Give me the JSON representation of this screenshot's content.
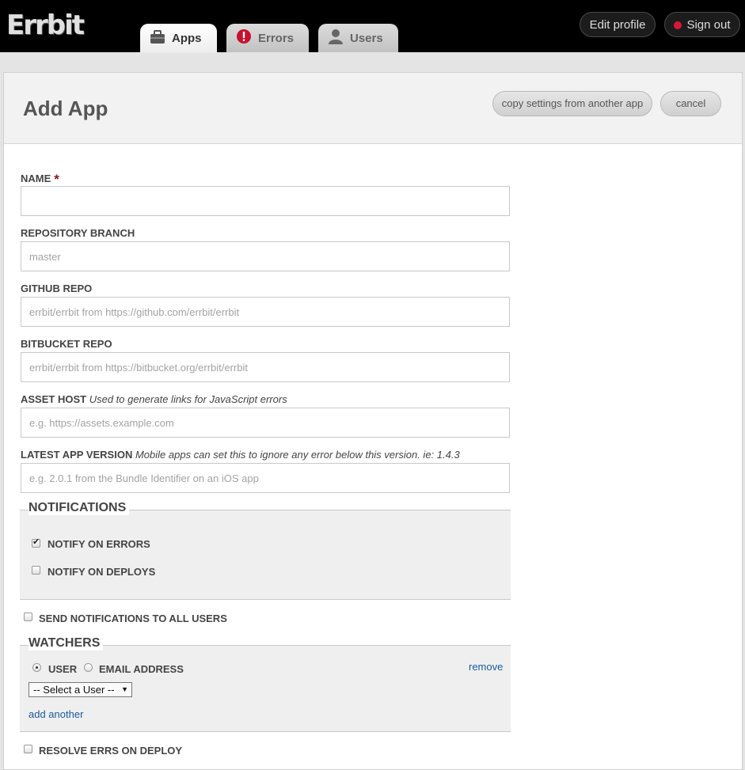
{
  "header": {
    "logo": "Errbit",
    "tabs": [
      {
        "label": "Apps",
        "icon": "briefcase-icon",
        "active": true
      },
      {
        "label": "Errors",
        "icon": "exclamation-icon",
        "active": false
      },
      {
        "label": "Users",
        "icon": "user-icon",
        "active": false
      }
    ],
    "edit_profile": "Edit profile",
    "sign_out": "Sign out",
    "sign_out_dot_color": "#d9163a"
  },
  "page": {
    "title": "Add App",
    "copy_settings": "copy settings from another app",
    "cancel": "cancel"
  },
  "form": {
    "name": {
      "label": "NAME",
      "required_mark": "*",
      "value": "",
      "placeholder": ""
    },
    "repository_branch": {
      "label": "REPOSITORY BRANCH",
      "placeholder": "master"
    },
    "github_repo": {
      "label": "GITHUB REPO",
      "placeholder": "errbit/errbit from https://github.com/errbit/errbit"
    },
    "bitbucket_repo": {
      "label": "BITBUCKET REPO",
      "placeholder": "errbit/errbit from https://bitbucket.org/errbit/errbit"
    },
    "asset_host": {
      "label": "ASSET HOST",
      "hint": "Used to generate links for JavaScript errors",
      "placeholder": "e.g. https://assets.example.com"
    },
    "latest_app_version": {
      "label": "LATEST APP VERSION",
      "hint": "Mobile apps can set this to ignore any error below this version. ie: 1.4.3",
      "placeholder": "e.g. 2.0.1 from the Bundle Identifier on an iOS app"
    },
    "notifications": {
      "legend": "NOTIFICATIONS",
      "notify_on_errors": {
        "label": "NOTIFY ON ERRORS",
        "checked": true
      },
      "notify_on_deploys": {
        "label": "NOTIFY ON DEPLOYS",
        "checked": false
      }
    },
    "send_to_all": {
      "label": "SEND NOTIFICATIONS TO ALL USERS",
      "checked": false
    },
    "watchers": {
      "legend": "WATCHERS",
      "user_option": {
        "label": "USER",
        "checked": true
      },
      "email_option": {
        "label": "EMAIL ADDRESS",
        "checked": false
      },
      "remove": "remove",
      "select_value": "-- Select a User --",
      "add_another": "add another"
    },
    "resolve_on_deploy": {
      "label": "RESOLVE ERRS ON DEPLOY",
      "checked": false
    }
  }
}
